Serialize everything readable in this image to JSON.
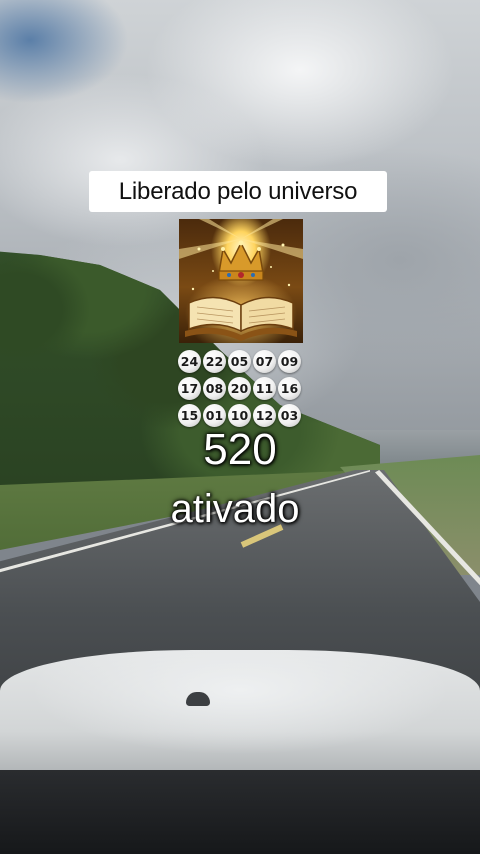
{
  "caption": "Liberado pelo universo",
  "image": {
    "icon": "crown-bible-icon"
  },
  "numbers": [
    [
      "24",
      "22",
      "05",
      "07",
      "09"
    ],
    [
      "17",
      "08",
      "20",
      "11",
      "16"
    ],
    [
      "15",
      "01",
      "10",
      "12",
      "03"
    ]
  ],
  "big_number": "520",
  "big_word": "ativado"
}
